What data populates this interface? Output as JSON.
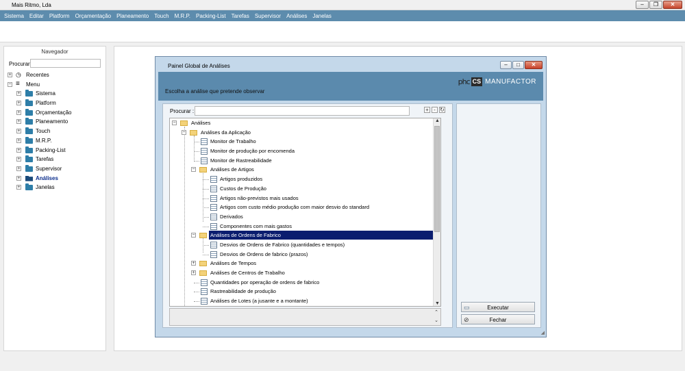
{
  "window": {
    "title": "Mais Ritmo, Lda"
  },
  "menu": [
    "Sistema",
    "Editar",
    "Platform",
    "Orçamentação",
    "Planeamento",
    "Touch",
    "M.R.P.",
    "Packing-List",
    "Tarefas",
    "Supervisor",
    "Análises",
    "Janelas"
  ],
  "navigator": {
    "title": "Navegador",
    "search_label": "Procurar:",
    "recent_label": "Recentes",
    "menu_label": "Menu",
    "items": [
      "Sistema",
      "Platform",
      "Orçamentação",
      "Planeamento",
      "Touch",
      "M.R.P.",
      "Packing-List",
      "Tarefas",
      "Supervisor",
      "Análises",
      "Janelas"
    ],
    "active_item": "Análises"
  },
  "dialog": {
    "title": "Painel Global de Análises",
    "prompt": "Escolha a análise que pretende observar",
    "brand": {
      "phc": "phc",
      "cs": "CS",
      "name": "MANUFACTOR"
    },
    "search_label": "Procurar :",
    "tree_tools": [
      "+",
      "-",
      "↻"
    ],
    "tree": {
      "root": "Análises",
      "app_group": "Análises da Aplicação",
      "app_items": [
        "Monitor de Trabalho",
        "Monitor de produção por encomenda",
        "Monitor de Rastreabilidade"
      ],
      "artigos_group": "Análises de Artigos",
      "artigos_items": [
        "Artigos produzidos",
        "Custos de Produção",
        "Artigos não-previstos mais usados",
        "Artigos com custo médio produção com maior desvio do standard",
        "Derivados",
        "Componentes com mais gastos"
      ],
      "ordens_group": "Análises de Ordens de Fabrico",
      "ordens_items": [
        "Desvios de Ordens de Fabrico (quantidades e tempos)",
        "Desvios de Ordens de fabrico (prazos)"
      ],
      "tempos_group": "Análises de Tempos",
      "centros_group": "Análises de Centros de Trabalho",
      "tail_items": [
        "Quantidades por operação de ordens de fabrico",
        "Rastreabilidade de produção",
        "Análises de Lotes (a jusante e a montante)"
      ]
    },
    "buttons": {
      "execute": "Executar",
      "close": "Fechar"
    }
  }
}
